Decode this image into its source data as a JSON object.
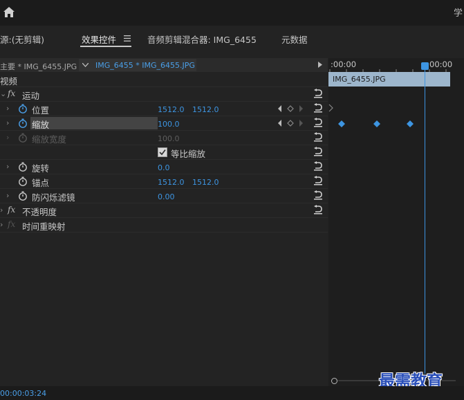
{
  "app": {
    "top_right_text": "学"
  },
  "tabs": [
    {
      "label": "源:(无剪辑)"
    },
    {
      "label": "效果控件"
    },
    {
      "label": "音频剪辑混合器: IMG_6455"
    },
    {
      "label": "元数据"
    }
  ],
  "tab_menu_icon": "hamburger-menu-icon",
  "clip_bar": {
    "master": "主要 * IMG_6455.JPG",
    "sequence": "IMG_6455 * IMG_6455.JPG"
  },
  "section": {
    "video": "视频"
  },
  "effects": {
    "motion": "运动",
    "position": {
      "label": "位置",
      "x": "1512.0",
      "y": "1512.0"
    },
    "scale": {
      "label": "缩放",
      "value": "100.0"
    },
    "scale_width": {
      "label": "缩放宽度",
      "value": "100.0"
    },
    "uniform_scale": {
      "label": "等比缩放",
      "checked": true
    },
    "rotation": {
      "label": "旋转",
      "value": "0.0"
    },
    "anchor": {
      "label": "锚点",
      "x": "1512.0",
      "y": "1512.0"
    },
    "anti_flicker": {
      "label": "防闪烁滤镜",
      "value": "0.00"
    },
    "opacity": "不透明度",
    "time_remap": "时间重映射"
  },
  "fx_label": "fx",
  "timeline": {
    "start_time": ":00:00",
    "end_time": "00:00",
    "clip_name": "IMG_6455.JPG",
    "keyframes_count": 3
  },
  "status": {
    "timecode": "00:00:03:24"
  },
  "watermark": "最需教育",
  "colors": {
    "accent": "#3d95e2",
    "clip": "#9db6cc"
  }
}
